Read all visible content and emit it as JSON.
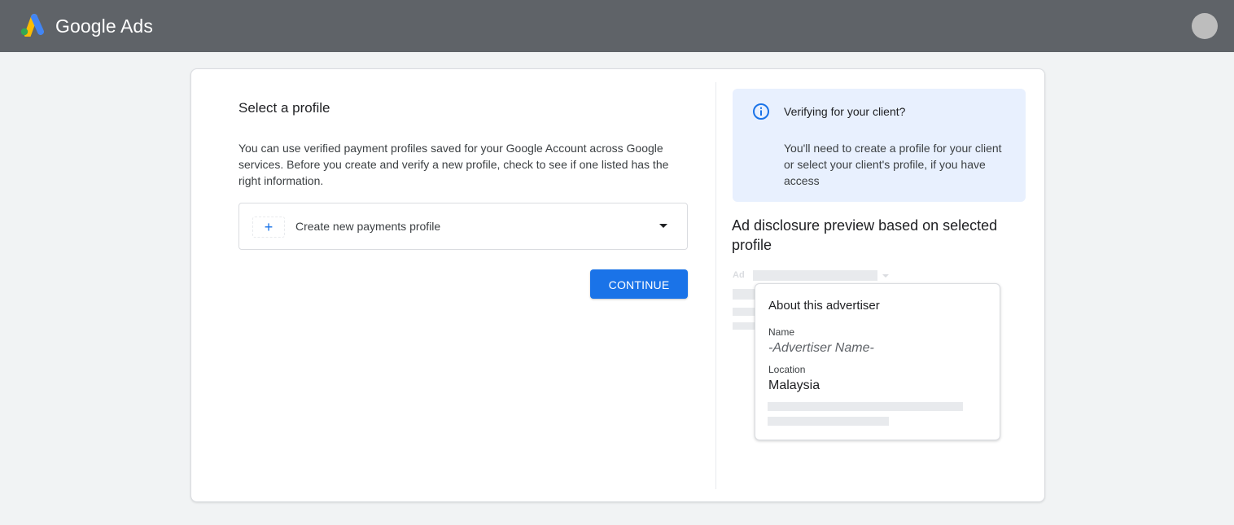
{
  "header": {
    "brand": "Google Ads",
    "logo_icon": "google-ads-logo-icon",
    "avatar_icon": "account-avatar"
  },
  "main": {
    "title": "Select a profile",
    "intro": "You can use verified payment profiles saved for your Google Account across Google services. Before you create and verify a new profile, check to see if one listed has the right information.",
    "profile_select": {
      "icon": "plus-icon",
      "icon_glyph": "+",
      "value": "Create new payments profile",
      "caret_icon": "dropdown-caret-icon"
    },
    "continue_label": "CONTINUE"
  },
  "side": {
    "info": {
      "icon": "info-icon",
      "title": "Verifying for your client?",
      "text": "You'll need to create a profile for your client or select your client's profile, if you have access"
    },
    "preview_title": "Ad disclosure preview based on selected profile",
    "ad_label": "Ad",
    "advertiser_card": {
      "title": "About this advertiser",
      "name_label": "Name",
      "name_value": "-Advertiser Name-",
      "location_label": "Location",
      "location_value": "Malaysia"
    }
  },
  "colors": {
    "topbar": "#5f6368",
    "primary": "#1a73e8",
    "info_bg": "#e8f0fe",
    "page_bg": "#f1f3f4"
  }
}
